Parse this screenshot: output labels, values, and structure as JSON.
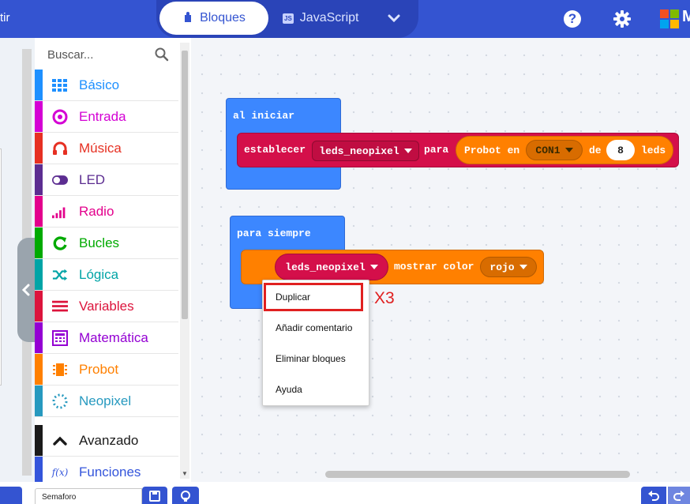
{
  "header": {
    "left_text": "tir",
    "tab_blocks": "Bloques",
    "tab_javascript": "JavaScript",
    "js_badge": "JS",
    "help_symbol": "?",
    "brand_text": "M"
  },
  "colors": {
    "header": "#3454d1",
    "hat_block": "#3c87ff",
    "neopixel_block": "#d40f4a",
    "probot_block": "#ff8000",
    "annotation": "#e02020"
  },
  "toolbox": {
    "search_placeholder": "Buscar...",
    "categories": [
      {
        "label": "Básico",
        "color": "#1e90ff",
        "icon": "grid-icon"
      },
      {
        "label": "Entrada",
        "color": "#d400d4",
        "icon": "target-icon"
      },
      {
        "label": "Música",
        "color": "#e63022",
        "icon": "headphones-icon"
      },
      {
        "label": "LED",
        "color": "#5c2d91",
        "icon": "toggle-icon"
      },
      {
        "label": "Radio",
        "color": "#e3008c",
        "icon": "signal-bars-icon"
      },
      {
        "label": "Bucles",
        "color": "#00aa00",
        "icon": "loop-arrow-icon"
      },
      {
        "label": "Lógica",
        "color": "#00a4a6",
        "icon": "shuffle-icon"
      },
      {
        "label": "Variables",
        "color": "#dc143c",
        "icon": "list-lines-icon"
      },
      {
        "label": "Matemática",
        "color": "#9400d3",
        "icon": "calculator-icon"
      },
      {
        "label": "Probot",
        "color": "#ff8000",
        "icon": "chip-icon"
      },
      {
        "label": "Neopixel",
        "color": "#2699bf",
        "icon": "dotted-circle-icon"
      }
    ],
    "advanced": {
      "label": "Avanzado",
      "color": "#1a1a1a",
      "icon": "chevron-up-icon"
    },
    "functions": {
      "label": "Funciones",
      "color": "#3455db",
      "icon": "function-icon",
      "icon_text": "f(x)"
    }
  },
  "workspace": {
    "on_start": {
      "hat_label": "al iniciar",
      "set_prefix": "establecer",
      "set_var": "leds_neopixel",
      "set_to": "para",
      "probot_label": "Probot en",
      "port": "CON1",
      "of_label": "de",
      "led_count": "8",
      "leds_label": "leds"
    },
    "forever": {
      "hat_label": "para siempre",
      "var": "leds_neopixel",
      "action": "mostrar color",
      "color_value": "rojo"
    }
  },
  "context_menu": {
    "items": [
      "Duplicar",
      "Añadir comentario",
      "Eliminar bloques",
      "Ayuda"
    ],
    "annotation": "X3"
  },
  "bottombar": {
    "project_name": "Semaforo"
  }
}
